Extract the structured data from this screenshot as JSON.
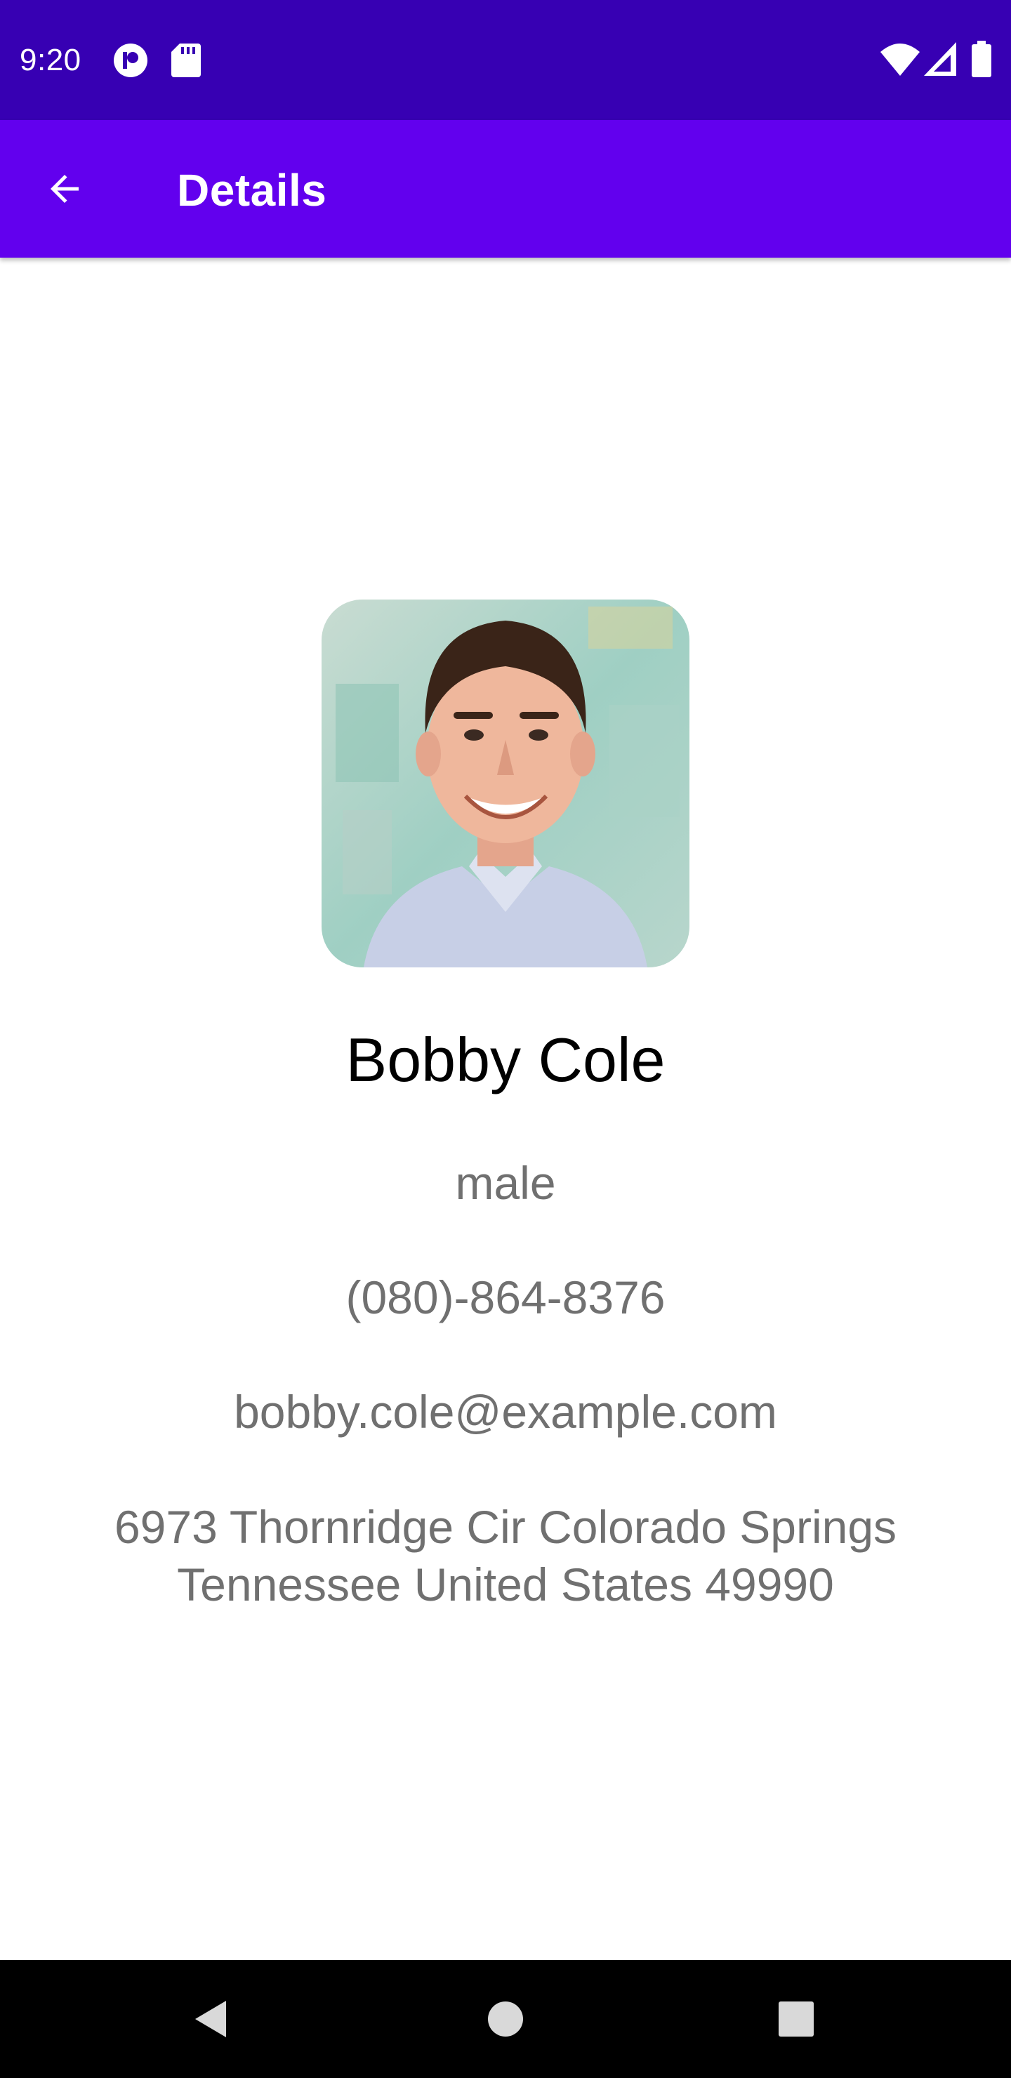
{
  "status_bar": {
    "time": "9:20",
    "background": "#3700B3",
    "left_icons": [
      "record-icon",
      "sd-card-icon"
    ],
    "right_icons": [
      "wifi-icon",
      "cell-signal-icon",
      "battery-icon"
    ]
  },
  "app_bar": {
    "title": "Details",
    "background": "#6200EE",
    "back_icon": "arrow-back-icon"
  },
  "contact": {
    "name": "Bobby Cole",
    "gender": "male",
    "phone": "(080)-864-8376",
    "email": "bobby.cole@example.com",
    "address": "6973 Thornridge Cir Colorado Springs Tennessee United States 49990"
  },
  "nav_bar": {
    "buttons": [
      "back-triangle-icon",
      "home-circle-icon",
      "recents-square-icon"
    ]
  }
}
